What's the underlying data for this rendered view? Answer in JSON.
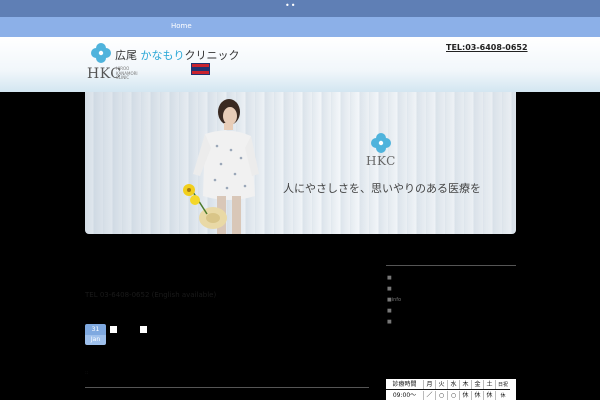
{
  "topbar": {
    "dots": "••"
  },
  "nav": {
    "home": "Home"
  },
  "header": {
    "name_plain": "広尾 ",
    "name_accent": "かなもり",
    "name_rest": "クリニック",
    "logo_abbr": "HKC",
    "logo_sub": "HIROO\nKANAMORI\nCLINIC",
    "tel": "TEL:03-6408-0652"
  },
  "hero": {
    "logo_abbr": "HKC",
    "slogan": "人にやさしさを、思いやりのある医療を"
  },
  "post": {
    "tel_line": "TEL 03-6408-0652 (English available)",
    "day": "31",
    "month": "Jan",
    "meta": "    ",
    "tag": "::"
  },
  "sidebar": {
    "items": [
      "■",
      "■",
      "■info",
      "■",
      "■"
    ]
  },
  "hours": {
    "header_label": "診療時間",
    "days": [
      "月",
      "火",
      "水",
      "木",
      "金",
      "土",
      "日祝"
    ],
    "row1_label": "09:00～13:00",
    "row1_marks": [
      "／",
      "○",
      "○",
      "休",
      "休",
      "休",
      "休"
    ]
  },
  "colors": {
    "topbar": "#5f7fb5",
    "navbar": "#8cb0e8",
    "accent": "#2aa7d6",
    "date_badge": "#7fa9e0"
  }
}
